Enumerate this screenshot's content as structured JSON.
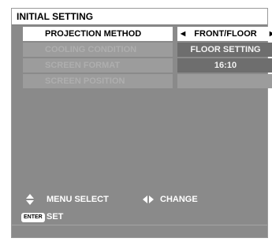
{
  "window": {
    "title": "INITIAL SETTING"
  },
  "menu": {
    "items": [
      {
        "label": "PROJECTION METHOD",
        "value": "FRONT/FLOOR",
        "selected": true
      },
      {
        "label": "COOLING CONDITION",
        "value": "FLOOR SETTING",
        "selected": false
      },
      {
        "label": "SCREEN FORMAT",
        "value": "16:10",
        "selected": false
      },
      {
        "label": "SCREEN POSITION",
        "value": "",
        "selected": false
      }
    ]
  },
  "footer": {
    "menu_select": "MENU SELECT",
    "change": "CHANGE",
    "enter_badge": "ENTER",
    "set": "SET"
  },
  "icons": {
    "updown": "up-down-arrow-icon",
    "leftright": "left-right-arrow-icon",
    "left": "triangle-left-icon",
    "right": "triangle-right-icon"
  },
  "colors": {
    "panel": "#8a8a8a",
    "selected_bg": "#ffffff",
    "value_bg": "#6e6e6e",
    "label_bg": "#9c9c9c",
    "label_text": "#aeaeae"
  }
}
